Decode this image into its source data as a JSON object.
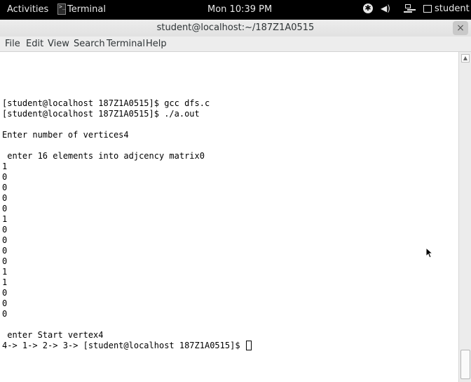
{
  "topbar": {
    "activities": "Activities",
    "app_name": "Terminal",
    "clock": "Mon 10:39 PM",
    "user": "student",
    "icons": [
      "terminal-app-icon",
      "accessibility-icon",
      "volume-icon",
      "network-icon",
      "user-icon"
    ]
  },
  "window": {
    "title": "student@localhost:~/187Z1A0515",
    "close_label": "×"
  },
  "menu": {
    "file": "File",
    "edit": "Edit",
    "view": "View",
    "search": "Search",
    "terminal": "Terminal",
    "help": "Help"
  },
  "terminal": {
    "lines": [
      "[student@localhost 187Z1A0515]$ gcc dfs.c",
      "[student@localhost 187Z1A0515]$ ./a.out",
      "",
      "Enter number of vertices4",
      "",
      " enter 16 elements into adjcency matrix0",
      "1",
      "0",
      "0",
      "0",
      "0",
      "1",
      "0",
      "0",
      "0",
      "0",
      "1",
      "1",
      "0",
      "0",
      "0",
      "",
      " enter Start vertex4",
      "4-> 1-> 2-> 3-> [student@localhost 187Z1A0515]$ "
    ]
  },
  "colors": {
    "topbar_bg": "#000000",
    "terminal_bg": "#ffffff",
    "terminal_fg": "#000000",
    "chrome_bg": "#ededed"
  }
}
